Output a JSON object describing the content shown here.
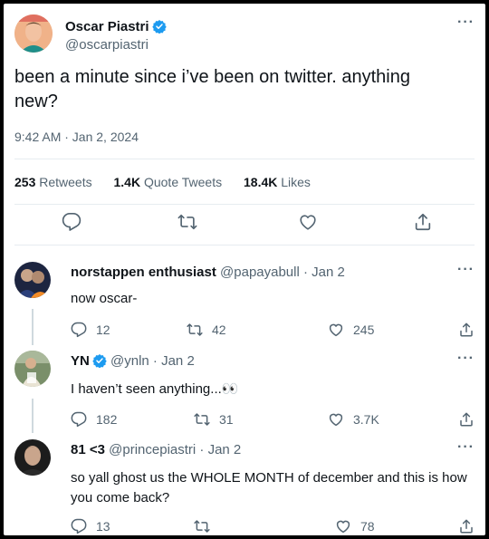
{
  "tweet": {
    "author_name": "Oscar Piastri",
    "author_handle": "@oscarpiastri",
    "text": "been a minute since i’ve been on twitter. anything new?",
    "timestamp": "9:42 AM · Jan 2, 2024",
    "stats": {
      "retweets_count": "253",
      "retweets_label": "Retweets",
      "quotes_count": "1.4K",
      "quotes_label": "Quote Tweets",
      "likes_count": "18.4K",
      "likes_label": "Likes"
    }
  },
  "replies": [
    {
      "name": "norstappen enthusiast",
      "handle": "@papayabull · Jan 2",
      "text": "now oscar-",
      "replies": "12",
      "retweets": "42",
      "likes": "245"
    },
    {
      "name": "YN",
      "handle": "@ynln · Jan 2",
      "text": "I haven’t seen anything...👀",
      "replies": "182",
      "retweets": "31",
      "likes": "3.7K"
    },
    {
      "name": "81 <3",
      "handle": "@princepiastri · Jan 2",
      "text": "so yall ghost us the WHOLE MONTH of december and this is how you come back?",
      "replies": "13",
      "retweets": "",
      "likes": "78"
    }
  ],
  "colors": {
    "verified": "#1d9bf0",
    "muted": "#536471",
    "text": "#0f1419",
    "divider": "#e6ecf0"
  },
  "icons": [
    "verified-badge-icon",
    "more-icon",
    "reply-icon",
    "retweet-icon",
    "like-icon",
    "share-icon"
  ],
  "more_label": "···"
}
